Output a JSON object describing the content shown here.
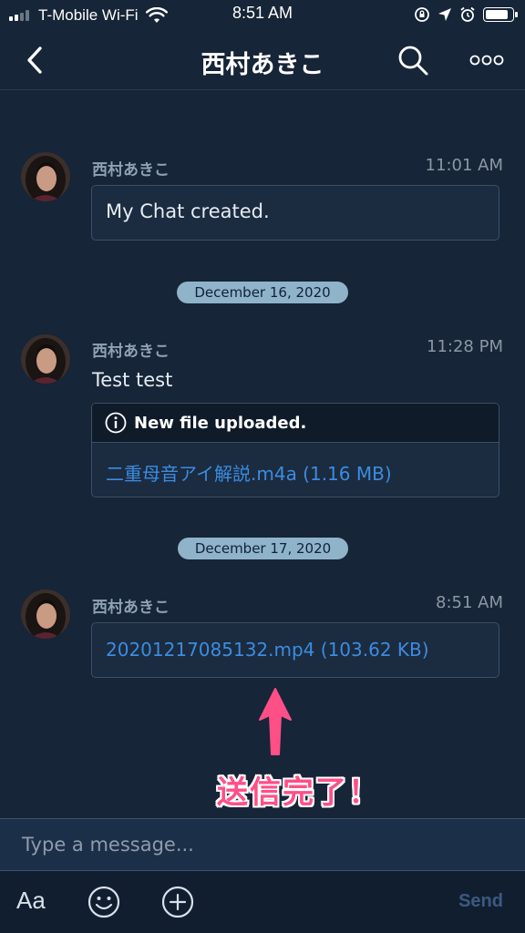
{
  "status_bar": {
    "carrier": "T-Mobile Wi-Fi",
    "time": "8:51 AM"
  },
  "header": {
    "title": "西村あきこ",
    "icons": {
      "back": "chevron-left-icon",
      "search": "search-icon",
      "more": "more-icon"
    }
  },
  "messages": [
    {
      "sender": "西村あきこ",
      "time": "11:01 AM",
      "text": "My Chat created."
    },
    {
      "date_divider": "December 16, 2020",
      "sender": "西村あきこ",
      "time": "11:28 PM",
      "text": "Test test",
      "file_card": {
        "header": "New file uploaded.",
        "file": "二重母音アイ解説.m4a (1.16 MB)"
      }
    },
    {
      "date_divider": "December 17, 2020",
      "sender": "西村あきこ",
      "time": "8:51 AM",
      "file": "20201217085132.mp4 (103.62 KB)"
    }
  ],
  "annotation": {
    "text": "送信完了！",
    "color": "#ff4f87"
  },
  "composer": {
    "placeholder": "Type a message...",
    "format_label": "Aa",
    "send_label": "Send"
  },
  "colors": {
    "background": "#162537",
    "bubble": "#1b2b40",
    "bubble_border": "#3c5068",
    "link": "#3c8ce0",
    "date_pill": "#8fb3c9"
  }
}
